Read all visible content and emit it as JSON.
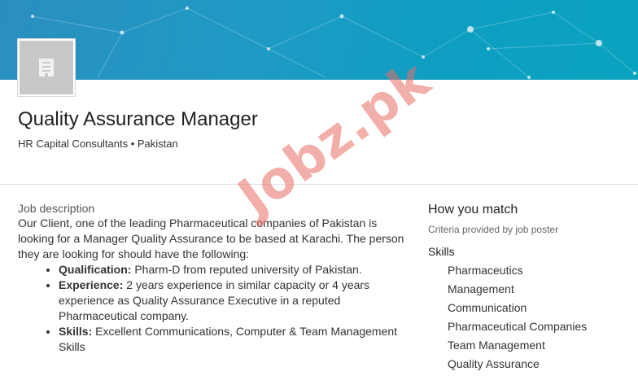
{
  "header": {
    "logo_icon": "building-icon",
    "job_title": "Quality Assurance Manager",
    "company_location": "HR Capital Consultants • Pakistan"
  },
  "description": {
    "label": "Job description",
    "intro": "Our Client, one of the leading Pharmaceutical companies of Pakistan is looking for a Manager Quality Assurance to be based at Karachi. The person they are looking for should have the following:",
    "items": [
      {
        "key": "Qualification:",
        "text": " Pharm-D from reputed university of Pakistan."
      },
      {
        "key": "Experience:",
        "text": " 2 years experience in similar capacity or 4 years experience as Quality Assurance Executive in a reputed Pharmaceutical company."
      },
      {
        "key": "Skills:",
        "text": " Excellent Communications, Computer & Team Management Skills"
      }
    ]
  },
  "match": {
    "title": "How you match",
    "subtitle": "Criteria provided by job poster",
    "skills_heading": "Skills",
    "skills": [
      "Pharmaceutics",
      "Management",
      "Communication",
      "Pharmaceutical Companies",
      "Team Management",
      "Quality Assurance"
    ]
  },
  "watermark": {
    "text": "Jobz.pk",
    "color": "#e86e64"
  },
  "colors": {
    "banner": "#1f9ac4"
  }
}
